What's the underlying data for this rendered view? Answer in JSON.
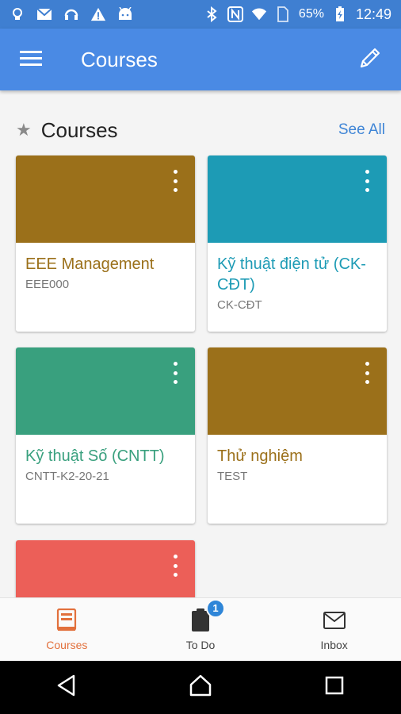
{
  "status_bar": {
    "battery_percent": "65%",
    "time": "12:49",
    "icons": [
      "brightness-icon",
      "gmail-icon",
      "headset-icon",
      "warning-icon",
      "android-icon",
      "bluetooth-icon",
      "nfc-icon",
      "wifi-icon",
      "sim-icon",
      "battery-icon"
    ]
  },
  "app_bar": {
    "title": "Courses",
    "menu_icon": "hamburger-menu-icon",
    "edit_icon": "pencil-icon",
    "background": "#4a8ae4"
  },
  "section": {
    "title": "Courses",
    "see_all": "See All",
    "icon": "star-icon"
  },
  "courses": [
    {
      "title": "EEE Management",
      "code": "EEE000",
      "color": "#9b701a"
    },
    {
      "title": "Kỹ thuật điện  tử (CK-CĐT)",
      "code": "CK-CĐT",
      "color": "#1d9bb5"
    },
    {
      "title": "Kỹ thuật Số (CNTT)",
      "code": "CNTT-K2-20-21",
      "color": "#39a07e"
    },
    {
      "title": "Thử nghiệm",
      "code": "TEST",
      "color": "#9b701a"
    },
    {
      "title": "",
      "code": "",
      "color": "#ec5f58"
    }
  ],
  "bottom_nav": {
    "items": [
      {
        "label": "Courses",
        "icon": "book-icon",
        "active": true
      },
      {
        "label": "To Do",
        "icon": "clipboard-icon",
        "badge": "1"
      },
      {
        "label": "Inbox",
        "icon": "envelope-icon"
      }
    ],
    "active_color": "#e2703c"
  },
  "system_nav": [
    "back-icon",
    "home-icon",
    "recents-icon"
  ]
}
